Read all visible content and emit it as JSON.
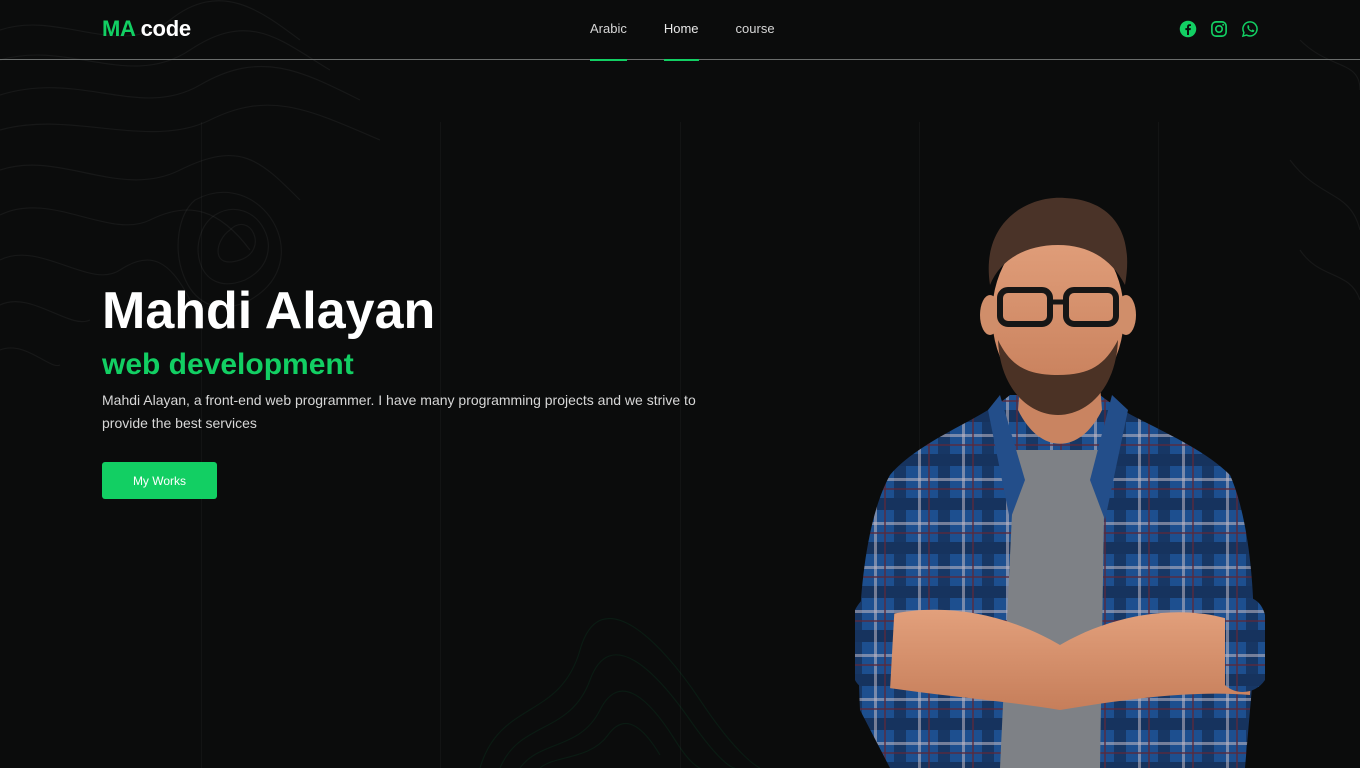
{
  "header": {
    "logo": {
      "accent": "MA",
      "rest": " code"
    },
    "nav": [
      {
        "label": "Arabic",
        "active": true
      },
      {
        "label": "Home",
        "active": true
      },
      {
        "label": "course",
        "active": false
      }
    ],
    "social": [
      "facebook-icon",
      "instagram-icon",
      "whatsapp-icon"
    ]
  },
  "hero": {
    "name": "Mahdi Alayan",
    "role": "web development",
    "description": "Mahdi Alayan, a front-end web programmer. I have many programming projects and we strive to provide the best services",
    "button_label": "My Works",
    "image": "portrait-photo"
  },
  "colors": {
    "accent": "#12cf63",
    "background": "#0b0c0c"
  }
}
